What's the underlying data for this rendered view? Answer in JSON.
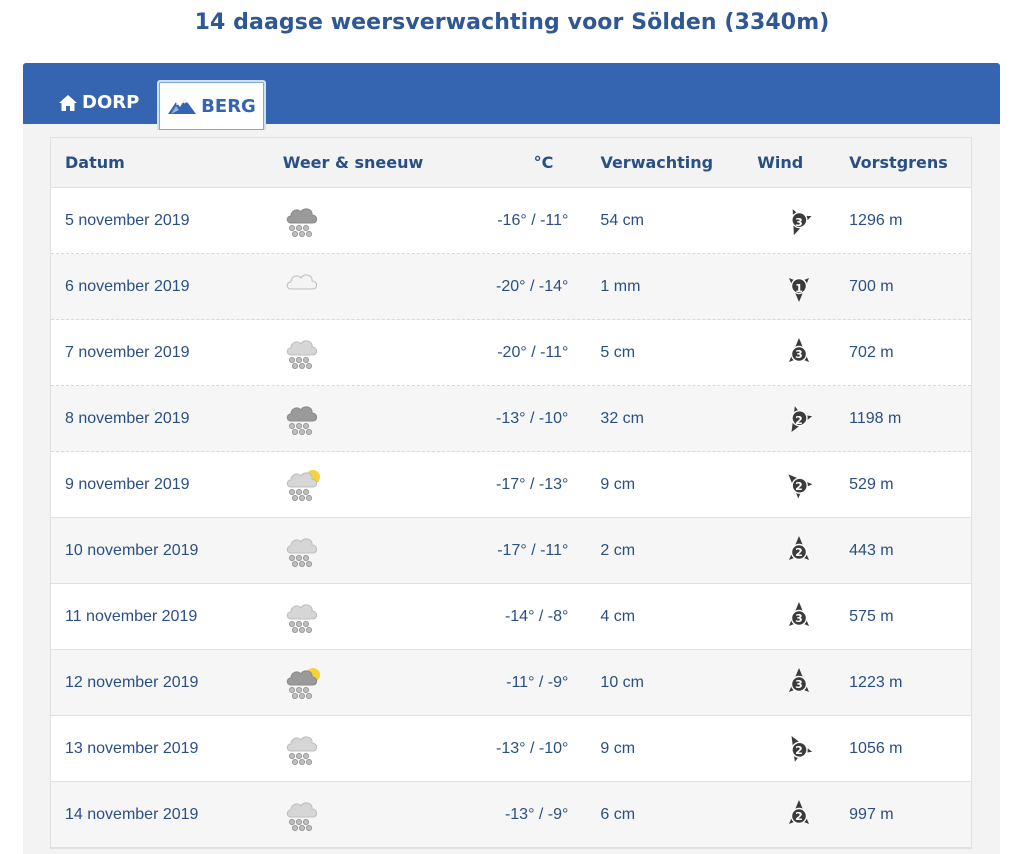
{
  "page": {
    "title": "14 daagse weersverwachting voor Sölden (3340m)"
  },
  "tabs": [
    {
      "label": "DORP",
      "icon": "house-icon",
      "active": false
    },
    {
      "label": "BERG",
      "icon": "mountain-icon",
      "active": true
    }
  ],
  "table": {
    "headers": {
      "date": "Datum",
      "weather": "Weer & sneeuw",
      "temp": "°C",
      "forecast": "Verwachting",
      "wind": "Wind",
      "frost": "Vorstgrens"
    },
    "rows": [
      {
        "date": "5 november 2019",
        "icon": "heavy-snow-cloud-icon",
        "temp": "-16° / -11°",
        "forecast": "54 cm",
        "wind_force": "3",
        "wind_dir": 200,
        "frost": "1296 m"
      },
      {
        "date": "6 november 2019",
        "icon": "cloud-icon",
        "temp": "-20° / -14°",
        "forecast": "1 mm",
        "wind_force": "1",
        "wind_dir": 180,
        "frost": "700 m"
      },
      {
        "date": "7 november 2019",
        "icon": "snow-cloud-icon",
        "temp": "-20° / -11°",
        "forecast": "5 cm",
        "wind_force": "3",
        "wind_dir": 0,
        "frost": "702 m"
      },
      {
        "date": "8 november 2019",
        "icon": "heavy-snow-cloud-icon",
        "temp": "-13° / -10°",
        "forecast": "32 cm",
        "wind_force": "2",
        "wind_dir": 210,
        "frost": "1198 m"
      },
      {
        "date": "9 november 2019",
        "icon": "snow-sun-cloud-icon",
        "temp": "-17° / -13°",
        "forecast": "9 cm",
        "wind_force": "2",
        "wind_dir": 315,
        "frost": "529 m"
      },
      {
        "date": "10 november 2019",
        "icon": "snow-cloud-icon",
        "temp": "-17° / -11°",
        "forecast": "2 cm",
        "wind_force": "2",
        "wind_dir": 0,
        "frost": "443 m"
      },
      {
        "date": "11 november 2019",
        "icon": "snow-cloud-icon",
        "temp": "-14° / -8°",
        "forecast": "4 cm",
        "wind_force": "3",
        "wind_dir": 0,
        "frost": "575 m"
      },
      {
        "date": "12 november 2019",
        "icon": "heavy-snow-sun-cloud-icon",
        "temp": "-11° / -9°",
        "forecast": "10 cm",
        "wind_force": "3",
        "wind_dir": 0,
        "frost": "1223 m"
      },
      {
        "date": "13 november 2019",
        "icon": "snow-cloud-icon",
        "temp": "-13° / -10°",
        "forecast": "9 cm",
        "wind_force": "2",
        "wind_dir": 330,
        "frost": "1056 m"
      },
      {
        "date": "14 november 2019",
        "icon": "snow-cloud-icon",
        "temp": "-13° / -9°",
        "forecast": "6 cm",
        "wind_force": "2",
        "wind_dir": 0,
        "frost": "997 m"
      }
    ]
  },
  "colors": {
    "accent": "#3565b0",
    "title": "#2f5793",
    "text": "#2a4f83",
    "sun": "#f7d23a"
  }
}
